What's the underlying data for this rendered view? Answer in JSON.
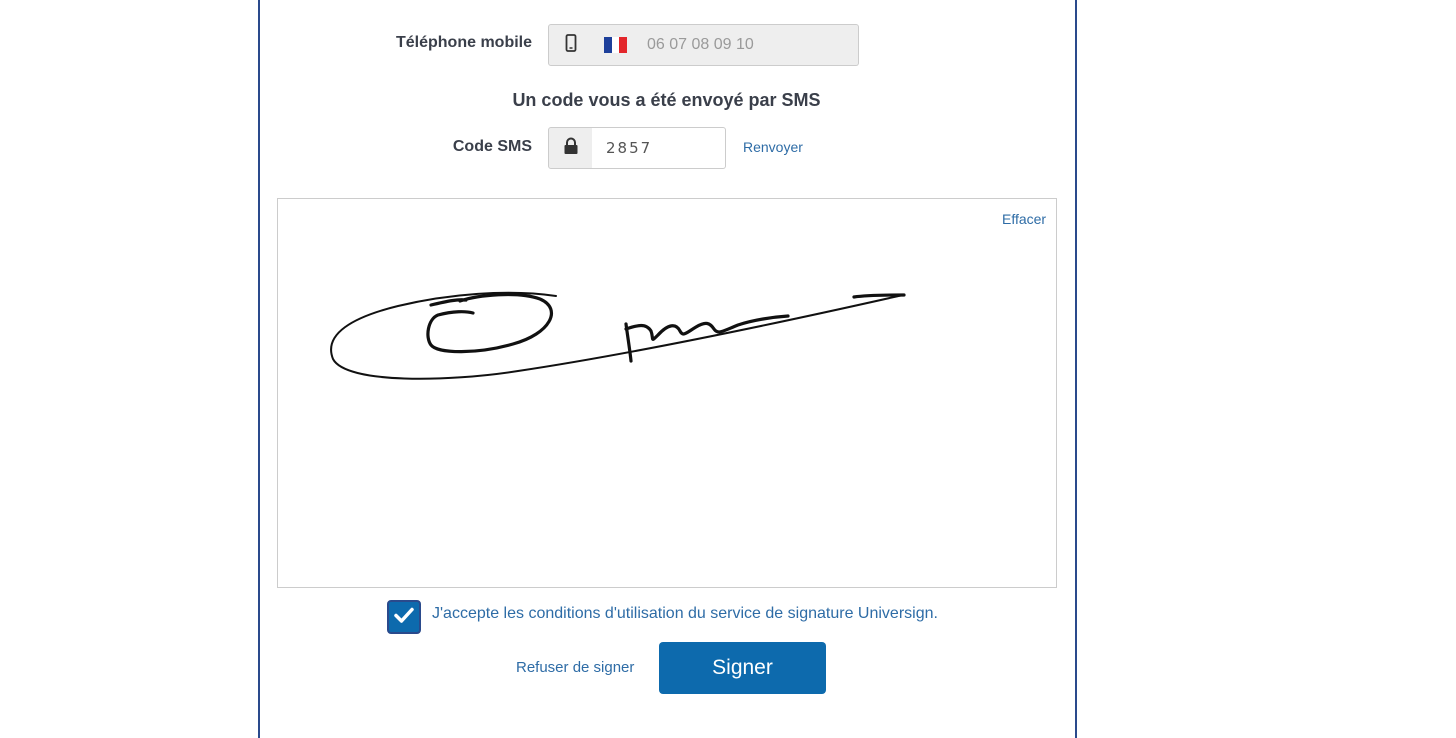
{
  "phone": {
    "label": "Téléphone mobile",
    "icon": "mobile-phone-icon",
    "country_flag": "fr-flag-icon",
    "placeholder": "06 07 08 09 10"
  },
  "sms": {
    "title": "Un code vous a été envoyé par SMS",
    "code_label": "Code SMS",
    "icon": "lock-icon",
    "code_value": "2857",
    "resend_label": "Renvoyer"
  },
  "signature_pad": {
    "clear_label": "Effacer"
  },
  "terms": {
    "checked": true,
    "text": "J'accepte les conditions d'utilisation du service de signature Universign."
  },
  "actions": {
    "refuse_label": "Refuser de signer",
    "sign_label": "Signer"
  },
  "colors": {
    "accent": "#0d6aad",
    "link": "#2e6ca6",
    "frame_border": "#2a4a8c",
    "label_text": "#3a3f4a"
  }
}
